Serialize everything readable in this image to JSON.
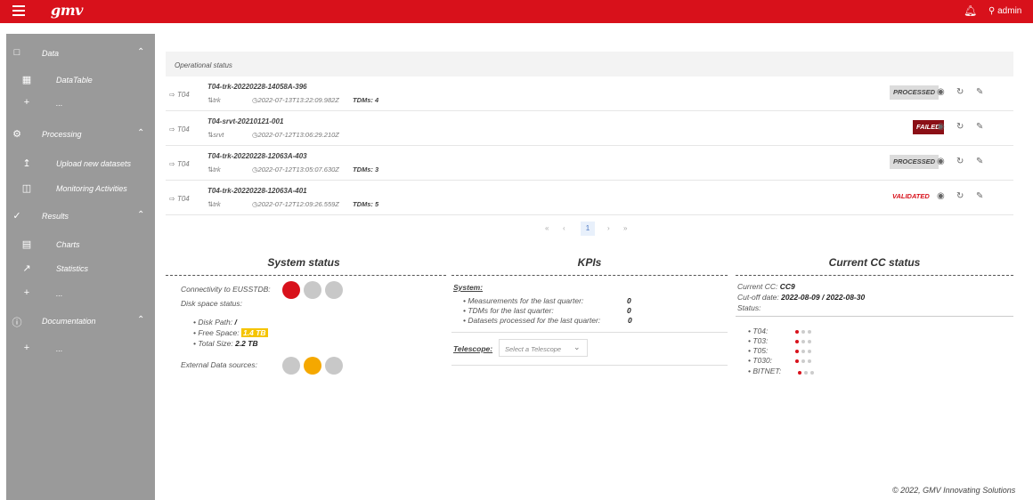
{
  "topbar": {
    "logo": "gmv",
    "username": "admin"
  },
  "sidebar": {
    "items": [
      {
        "label": "Data",
        "icon": "file-icon"
      },
      {
        "label": "DataTable",
        "icon": "table-icon"
      },
      {
        "label": "...",
        "icon": "plus-icon"
      },
      {
        "label": "Processing",
        "icon": "gear-icon"
      },
      {
        "label": "Upload new datasets",
        "icon": "upload-icon"
      },
      {
        "label": "Monitoring Activities",
        "icon": "monitor-icon"
      },
      {
        "label": "Results",
        "icon": "check-circle-icon"
      },
      {
        "label": "Charts",
        "icon": "chart-icon"
      },
      {
        "label": "Statistics",
        "icon": "trend-icon"
      },
      {
        "label": "...",
        "icon": "plus-icon"
      },
      {
        "label": "Documentation",
        "icon": "info-icon"
      },
      {
        "label": "...",
        "icon": "plus-icon"
      }
    ]
  },
  "operational": {
    "title": "Operational status",
    "rows": [
      {
        "telescope": "T04",
        "name": "T04-trk-20220228-14058A-396",
        "type": "trk",
        "time": "2022-07-13T13:22:09.982Z",
        "tdms": "TDMs: 4",
        "status": "PROCESSED"
      },
      {
        "telescope": "T04",
        "name": "T04-srvt-20210121-001",
        "type": "srvt",
        "time": "2022-07-12T13:06:29.210Z",
        "tdms": "",
        "status": "FAILED"
      },
      {
        "telescope": "T04",
        "name": "T04-trk-20220228-12063A-403",
        "type": "trk",
        "time": "2022-07-12T13:05:07.630Z",
        "tdms": "TDMs: 3",
        "status": "PROCESSED"
      },
      {
        "telescope": "T04",
        "name": "T04-trk-20220228-12063A-401",
        "type": "trk",
        "time": "2022-07-12T12:09:26.559Z",
        "tdms": "TDMs: 5",
        "status": "VALIDATED"
      }
    ],
    "pager": {
      "first": "«",
      "prev": "‹",
      "page": "1",
      "next": "›",
      "last": "»"
    }
  },
  "system_status": {
    "title": "System status",
    "connectivity_label": "Connectivity to EUSSTDB:",
    "disk_label": "Disk space status:",
    "disk_path_label": "Disk Path:",
    "disk_path_value": "/",
    "free_label": "Free Space:",
    "free_value": "1.4 TB",
    "total_label": "Total Size:",
    "total_value": "2.2 TB",
    "external_label": "External Data sources:",
    "colors": {
      "red": "#d8111b",
      "grey": "#c8c8c8",
      "orange": "#f5a800"
    }
  },
  "kpis": {
    "title": "KPIs",
    "system_label": "System:",
    "items": [
      {
        "label": "Measurements for the last quarter:",
        "value": "0"
      },
      {
        "label": "TDMs for the last quarter:",
        "value": "0"
      },
      {
        "label": "Datasets processed for the last quarter:",
        "value": "0"
      }
    ],
    "telescope_label": "Telescope:",
    "telescope_placeholder": "Select a Telescope"
  },
  "cc_status": {
    "title": "Current CC status",
    "current_label": "Current CC:",
    "current_value": "CC9",
    "cutoff_label": "Cut-off date:",
    "cutoff_value": "2022-08-09 / 2022-08-30",
    "status_label": "Status:",
    "telescopes": [
      "T04:",
      "T03:",
      "T05:",
      "T030:",
      "BITNET:"
    ]
  },
  "footer": "© 2022, GMV Innovating Solutions"
}
